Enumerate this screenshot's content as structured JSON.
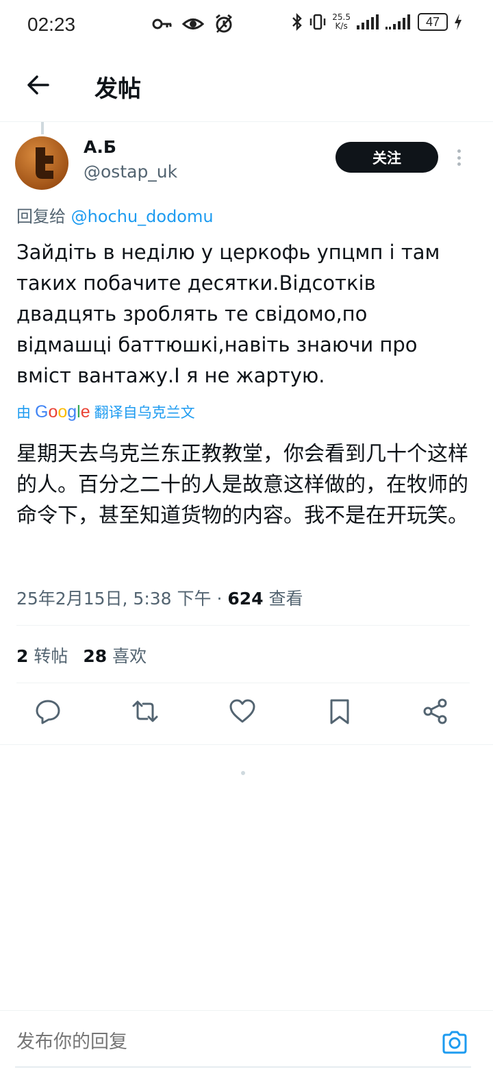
{
  "status_bar": {
    "time": "02:23",
    "net_speed_value": "25.5",
    "net_speed_unit": "K/s",
    "battery": "47"
  },
  "header": {
    "title": "发帖"
  },
  "post": {
    "display_name": "А.Б",
    "handle": "@ostap_uk",
    "follow_label": "关注",
    "reply_prefix": "回复给",
    "reply_mention": "@hochu_dodomu",
    "text": "Зайдіть в неділю у церкофь упцмп і там таких побачите десятки.Відсотків двадцять зроблять те свідомо,по відмашці баттюшкі,навіть знаючи про вміст вантажу.І я не жартую.",
    "translate_by": "由",
    "translate_brand": "Google",
    "translate_from": "翻译自乌克兰文",
    "translated_text": "星期天去乌克兰东正教教堂，你会看到几十个这样的人。百分之二十的人是故意这样做的，在牧师的命令下，甚至知道货物的内容。我不是在开玩笑。",
    "datetime": "25年2月15日, 5:38 下午",
    "separator": " · ",
    "views_count": "624",
    "views_label": "查看",
    "reposts_count": "2",
    "reposts_label": "转帖",
    "likes_count": "28",
    "likes_label": "喜欢"
  },
  "reply_bar": {
    "placeholder": "发布你的回复"
  },
  "icons": {
    "back": "back-arrow-icon",
    "reply": "comment-icon",
    "repost": "repost-icon",
    "like": "heart-icon",
    "bookmark": "bookmark-icon",
    "share": "share-icon",
    "camera": "camera-icon"
  },
  "colors": {
    "accent": "#1d9bf0",
    "text": "#0f1419",
    "muted": "#536471"
  }
}
